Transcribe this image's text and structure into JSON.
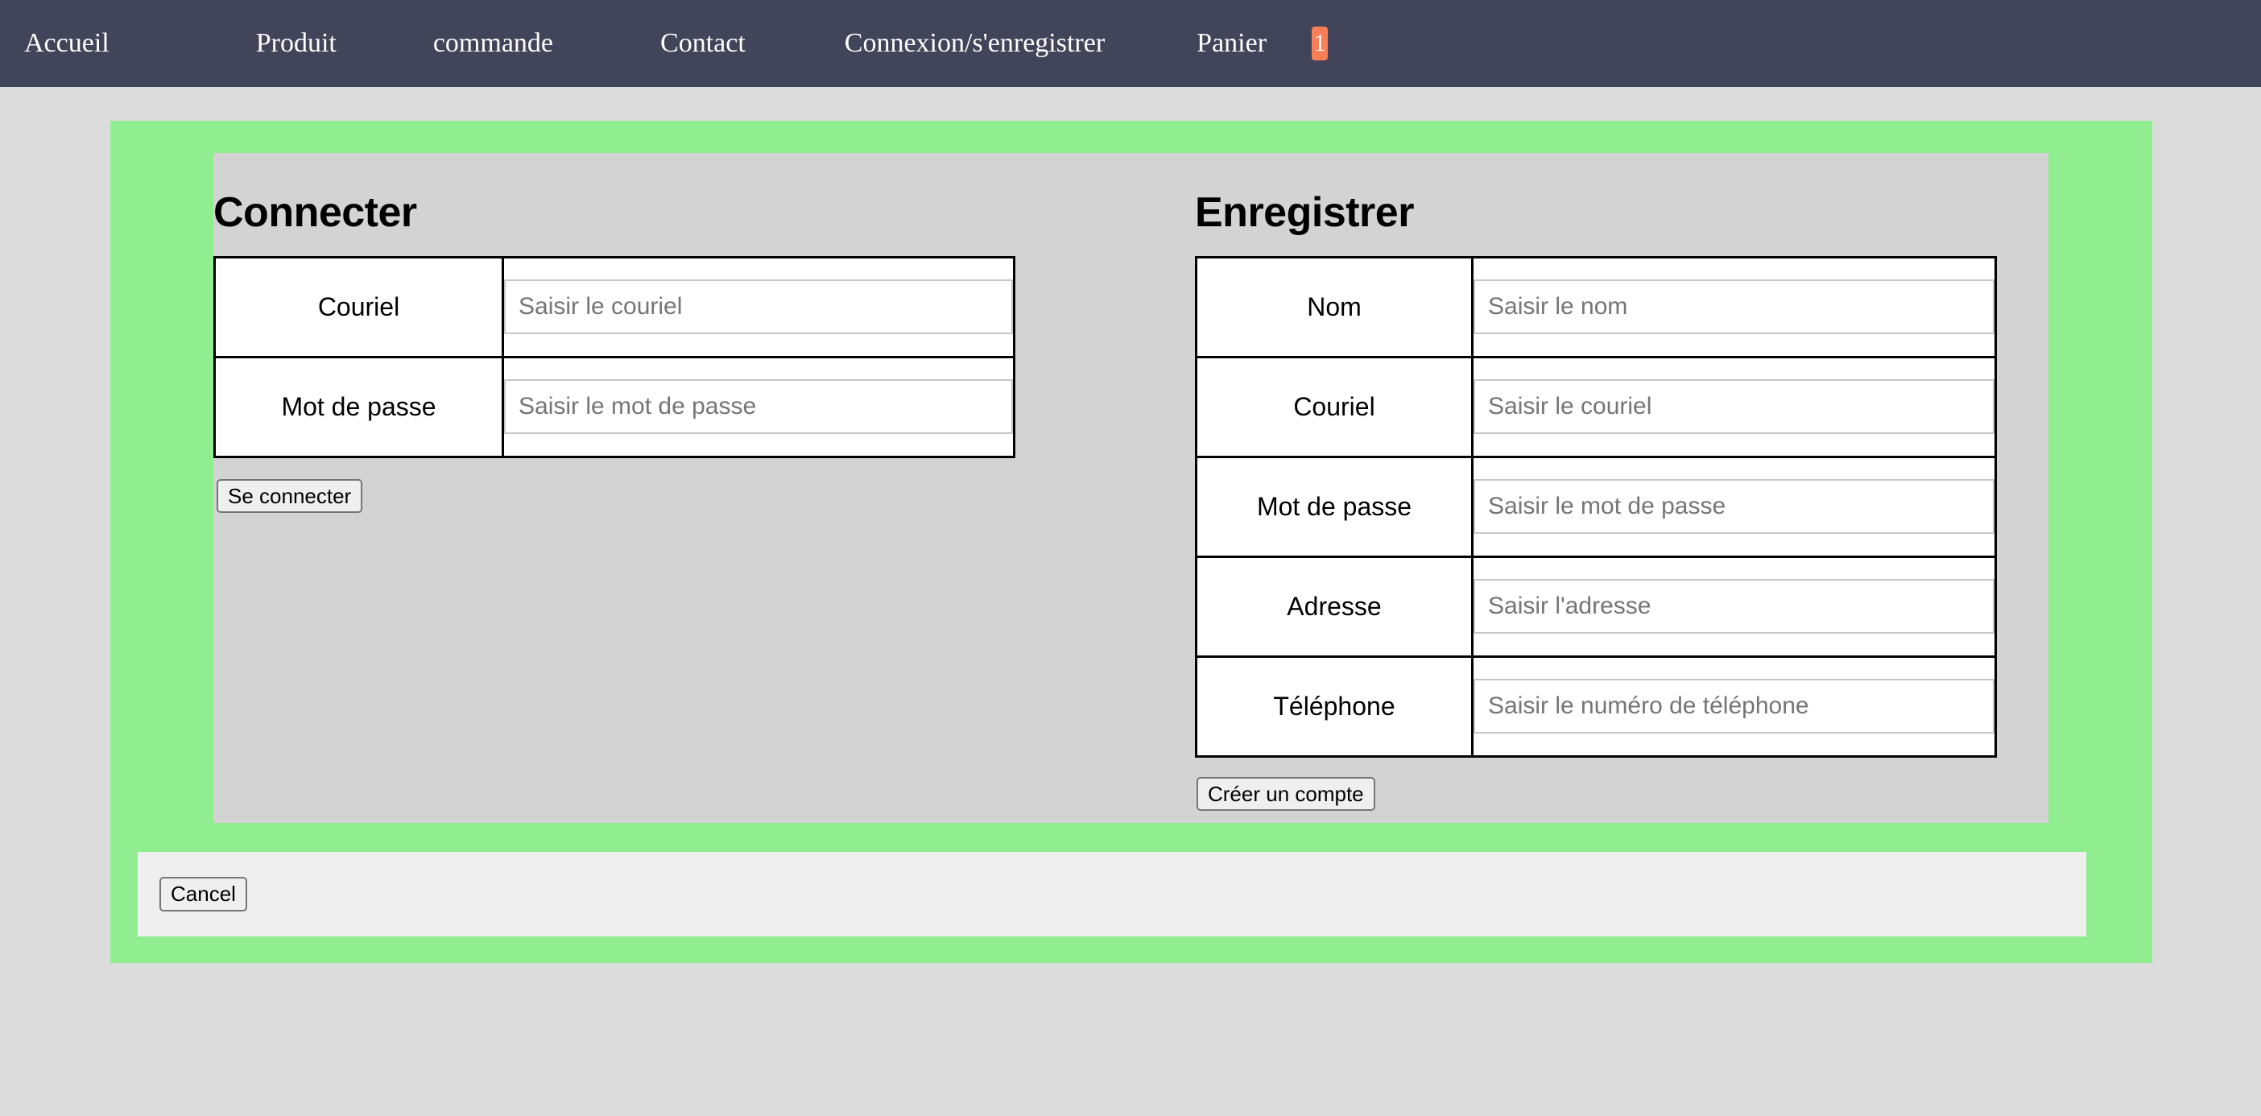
{
  "nav": {
    "items": [
      {
        "label": "Accueil",
        "name": "nav-item-accueil"
      },
      {
        "label": "Produit",
        "name": "nav-item-produit"
      },
      {
        "label": "commande",
        "name": "nav-item-commande"
      },
      {
        "label": "Contact",
        "name": "nav-item-contact"
      },
      {
        "label": "Connexion/s'enregistrer",
        "name": "nav-item-connexion"
      },
      {
        "label": "Panier",
        "name": "nav-item-panier"
      }
    ],
    "cart_badge_count": "1",
    "background_color": "#424559",
    "badge_color": "#f97f56",
    "text_color": "#ffffff"
  },
  "colors": {
    "page_background": "#dcdcdc",
    "container_green": "#90ee90",
    "panel_gray": "#d3d3d3",
    "cancel_bar_gray": "#efefef",
    "table_border": "#000000",
    "input_border": "#c6c6c6",
    "placeholder_text": "#757575"
  },
  "login": {
    "title": "Connecter",
    "rows": [
      {
        "label": "Couriel",
        "placeholder": "Saisir le couriel",
        "value": "",
        "type": "text",
        "name": "login-email"
      },
      {
        "label": "Mot de passe",
        "placeholder": "Saisir le mot de passe",
        "value": "",
        "type": "password",
        "name": "login-password"
      }
    ],
    "submit_label": "Se connecter"
  },
  "register": {
    "title": "Enregistrer",
    "rows": [
      {
        "label": "Nom",
        "placeholder": "Saisir le nom",
        "value": "",
        "type": "text",
        "name": "register-name"
      },
      {
        "label": "Couriel",
        "placeholder": "Saisir le couriel",
        "value": "",
        "type": "text",
        "name": "register-email"
      },
      {
        "label": "Mot de passe",
        "placeholder": "Saisir le mot de passe",
        "value": "",
        "type": "password",
        "name": "register-password"
      },
      {
        "label": "Adresse",
        "placeholder": "Saisir l'adresse",
        "value": "",
        "type": "text",
        "name": "register-address"
      },
      {
        "label": "Téléphone",
        "placeholder": "Saisir le numéro de téléphone",
        "value": "",
        "type": "text",
        "name": "register-phone"
      }
    ],
    "submit_label": "Créer un compte"
  },
  "footer": {
    "cancel_label": "Cancel"
  }
}
